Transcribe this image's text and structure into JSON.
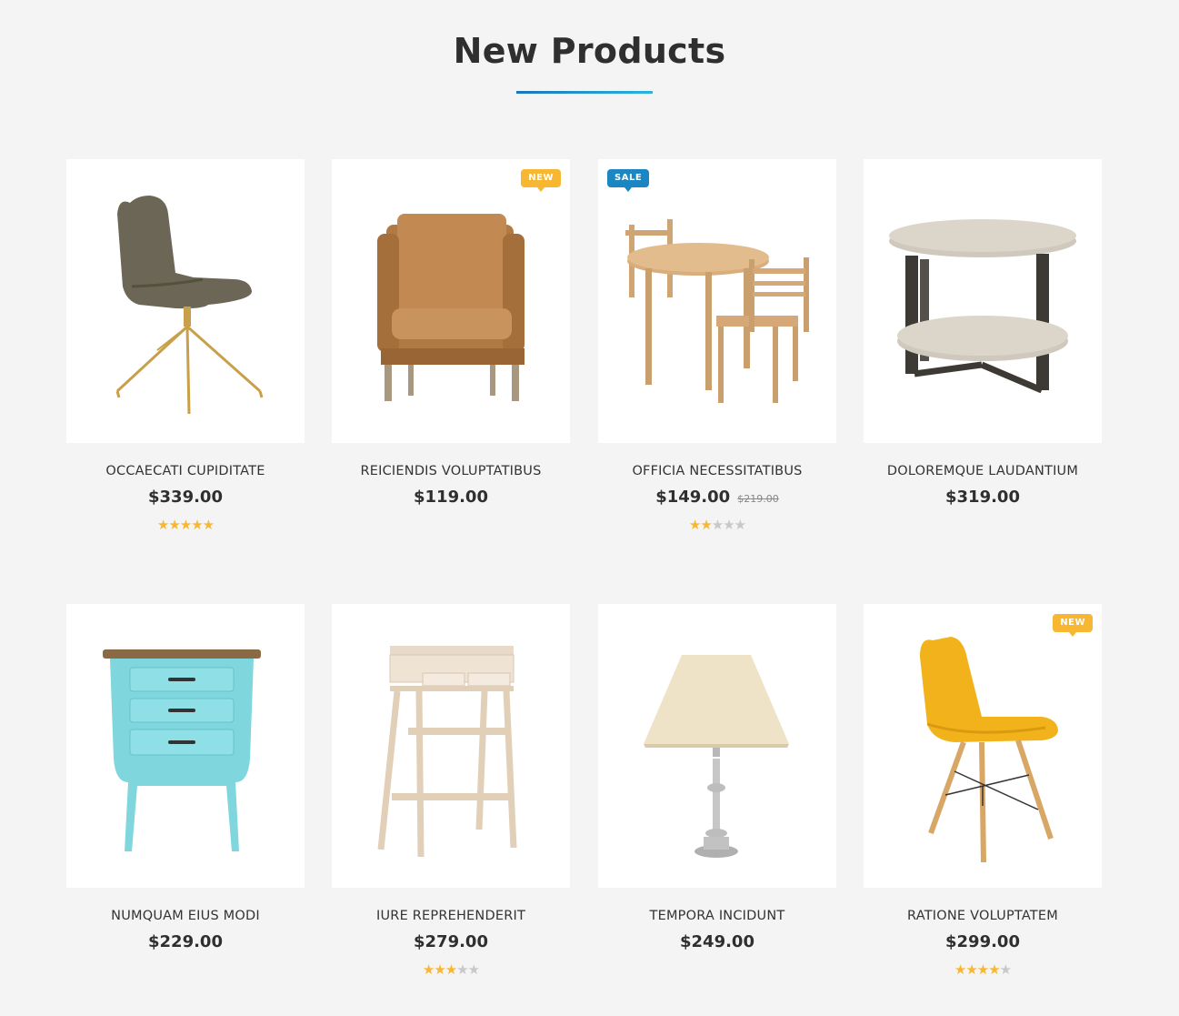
{
  "section": {
    "title": "New Products"
  },
  "colors": {
    "accent": "#1b86c1",
    "new_badge": "#f7b733",
    "sale_badge": "#1b86c1",
    "star": "#f7b733"
  },
  "products": [
    {
      "name": "OCCAECATI CUPIDITATE",
      "price": "$339.00",
      "old_price": "",
      "badge": "",
      "rating": 5,
      "image": "swivel-chair-icon"
    },
    {
      "name": "REICIENDIS VOLUPTATIBUS",
      "price": "$119.00",
      "old_price": "",
      "badge": "NEW",
      "rating": 0,
      "image": "armchair-icon"
    },
    {
      "name": "OFFICIA NECESSITATIBUS",
      "price": "$149.00",
      "old_price": "$219.00",
      "badge": "SALE",
      "rating": 2,
      "image": "dining-set-icon"
    },
    {
      "name": "DOLOREMQUE LAUDANTIUM",
      "price": "$319.00",
      "old_price": "",
      "badge": "",
      "rating": 0,
      "image": "side-table-icon"
    },
    {
      "name": "NUMQUAM EIUS MODI",
      "price": "$229.00",
      "old_price": "",
      "badge": "",
      "rating": 0,
      "image": "nightstand-icon"
    },
    {
      "name": "IURE REPREHENDERIT",
      "price": "$279.00",
      "old_price": "",
      "badge": "",
      "rating": 3,
      "image": "shelf-stand-icon"
    },
    {
      "name": "TEMPORA INCIDUNT",
      "price": "$249.00",
      "old_price": "",
      "badge": "",
      "rating": 0,
      "image": "table-lamp-icon"
    },
    {
      "name": "RATIONE VOLUPTATEM",
      "price": "$299.00",
      "old_price": "",
      "badge": "NEW",
      "rating": 4,
      "image": "yellow-chair-icon"
    }
  ]
}
